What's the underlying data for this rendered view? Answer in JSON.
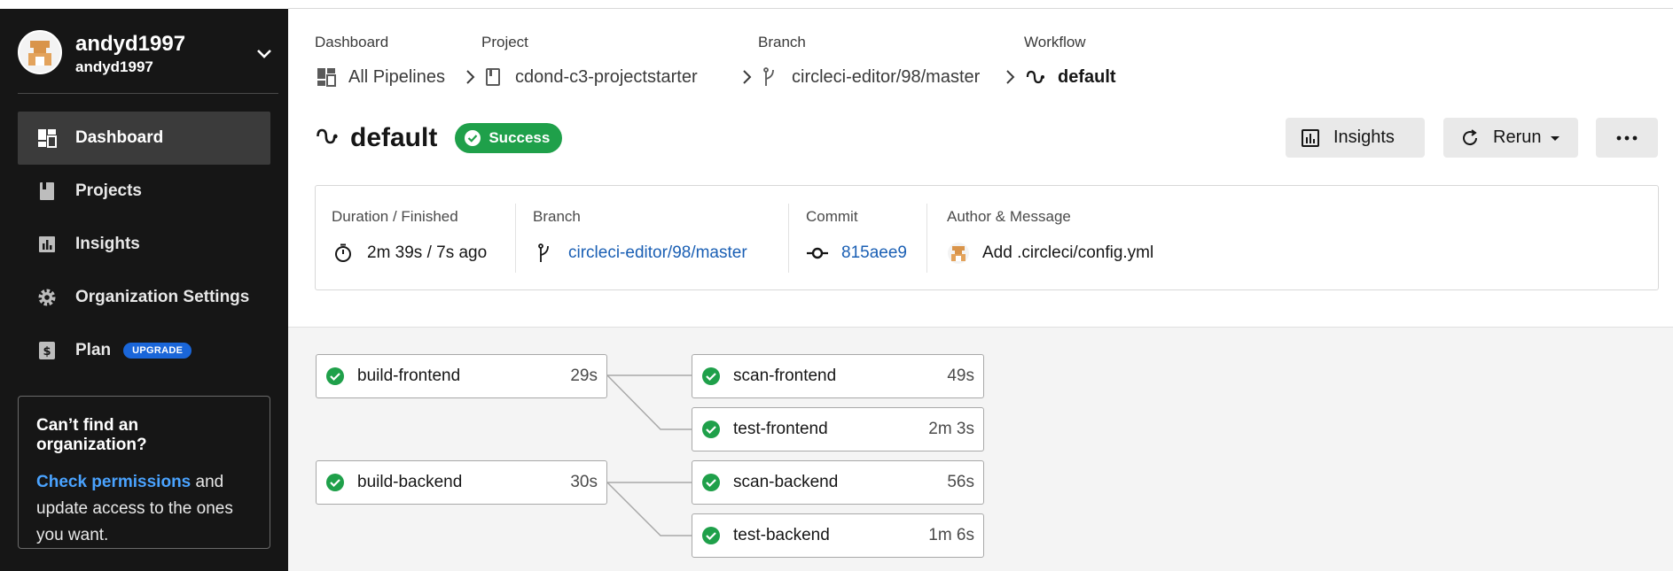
{
  "user": {
    "name": "andyd1997",
    "handle": "andyd1997"
  },
  "nav": {
    "items": [
      {
        "label": "Dashboard",
        "icon": "dashboard-icon"
      },
      {
        "label": "Projects",
        "icon": "book-icon"
      },
      {
        "label": "Insights",
        "icon": "bar-chart-icon"
      },
      {
        "label": "Organization Settings",
        "icon": "gear-icon"
      },
      {
        "label": "Plan",
        "icon": "dollar-icon",
        "badge": "UPGRADE"
      }
    ],
    "active": "Dashboard"
  },
  "org_box": {
    "title": "Can’t find an organization?",
    "link_text": "Check permissions",
    "text_after_link": " and update access to the ones you want."
  },
  "breadcrumb": {
    "items": [
      {
        "label": "Dashboard",
        "value": "All Pipelines"
      },
      {
        "label": "Project",
        "value": "cdond-c3-projectstarter"
      },
      {
        "label": "Branch",
        "value": "circleci-editor/98/master"
      },
      {
        "label": "Workflow",
        "value": "default"
      }
    ]
  },
  "header": {
    "title": "default",
    "status": "Success",
    "insights_label": "Insights",
    "rerun_label": "Rerun"
  },
  "info": {
    "duration_label": "Duration / Finished",
    "duration_value": "2m 39s / 7s ago",
    "branch_label": "Branch",
    "branch_value": "circleci-editor/98/master",
    "commit_label": "Commit",
    "commit_value": "815aee9",
    "author_label": "Author & Message",
    "author_message": "Add .circleci/config.yml"
  },
  "jobs": [
    {
      "name": "build-frontend",
      "duration": "29s",
      "status": "success"
    },
    {
      "name": "scan-frontend",
      "duration": "49s",
      "status": "success"
    },
    {
      "name": "test-frontend",
      "duration": "2m 3s",
      "status": "success"
    },
    {
      "name": "build-backend",
      "duration": "30s",
      "status": "success"
    },
    {
      "name": "scan-backend",
      "duration": "56s",
      "status": "success"
    },
    {
      "name": "test-backend",
      "duration": "1m 6s",
      "status": "success"
    }
  ],
  "colors": {
    "success": "#1fa04a",
    "sidebar": "#161616",
    "link": "#1a5fb4",
    "upgrade": "#1a66d9"
  }
}
